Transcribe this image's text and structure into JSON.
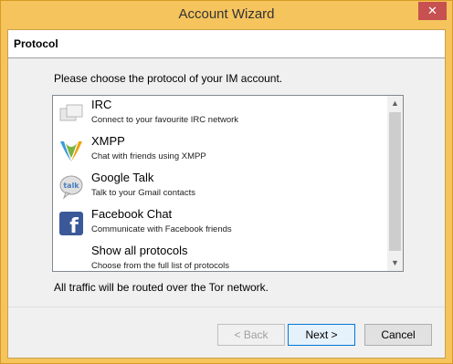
{
  "window": {
    "title": "Account Wizard",
    "close_label": "✕"
  },
  "header": {
    "title": "Protocol"
  },
  "intro": "Please choose the protocol of your IM account.",
  "protocols": [
    {
      "name": "IRC",
      "desc": "Connect to your favourite IRC network",
      "icon": "irc-icon"
    },
    {
      "name": "XMPP",
      "desc": "Chat with friends using XMPP",
      "icon": "xmpp-icon"
    },
    {
      "name": "Google Talk",
      "desc": "Talk to your Gmail contacts",
      "icon": "google-talk-icon"
    },
    {
      "name": "Facebook Chat",
      "desc": "Communicate with Facebook friends",
      "icon": "facebook-icon"
    },
    {
      "name": "Show all protocols",
      "desc": "Choose from the full list of protocols",
      "icon": ""
    }
  ],
  "footer_note": "All traffic will be routed over the Tor network.",
  "buttons": {
    "back": "< Back",
    "next": "Next >",
    "cancel": "Cancel"
  }
}
